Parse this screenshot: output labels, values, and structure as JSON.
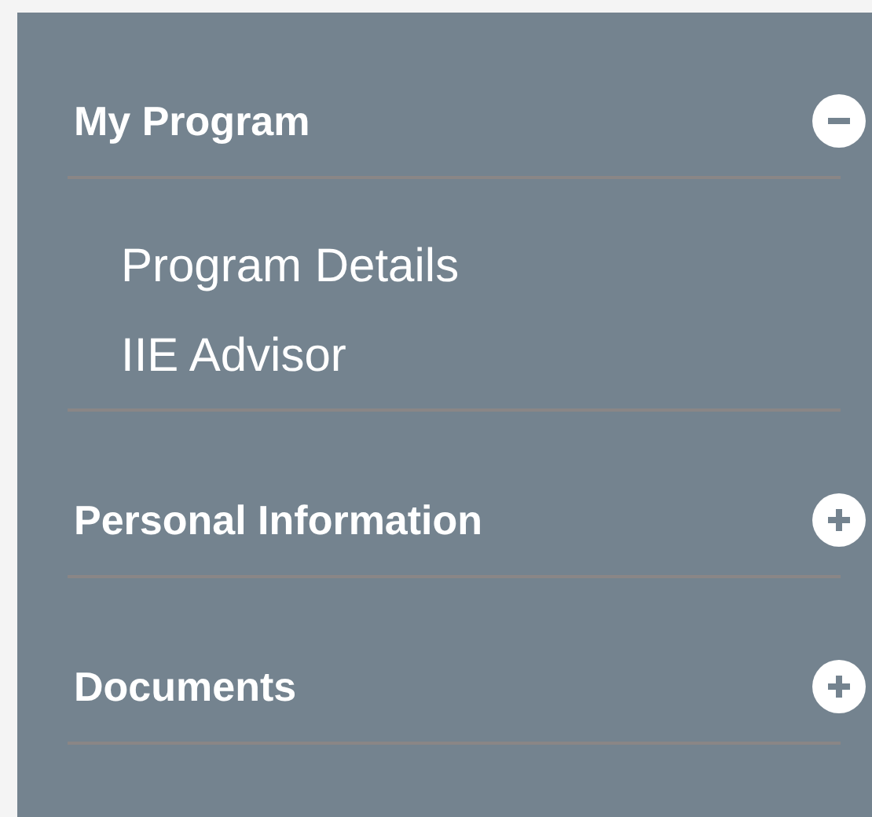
{
  "sections": [
    {
      "title": "My Program",
      "expanded": true,
      "items": [
        "Program Details",
        "IIE Advisor"
      ]
    },
    {
      "title": "Personal Information",
      "expanded": false
    },
    {
      "title": "Documents",
      "expanded": false
    }
  ]
}
